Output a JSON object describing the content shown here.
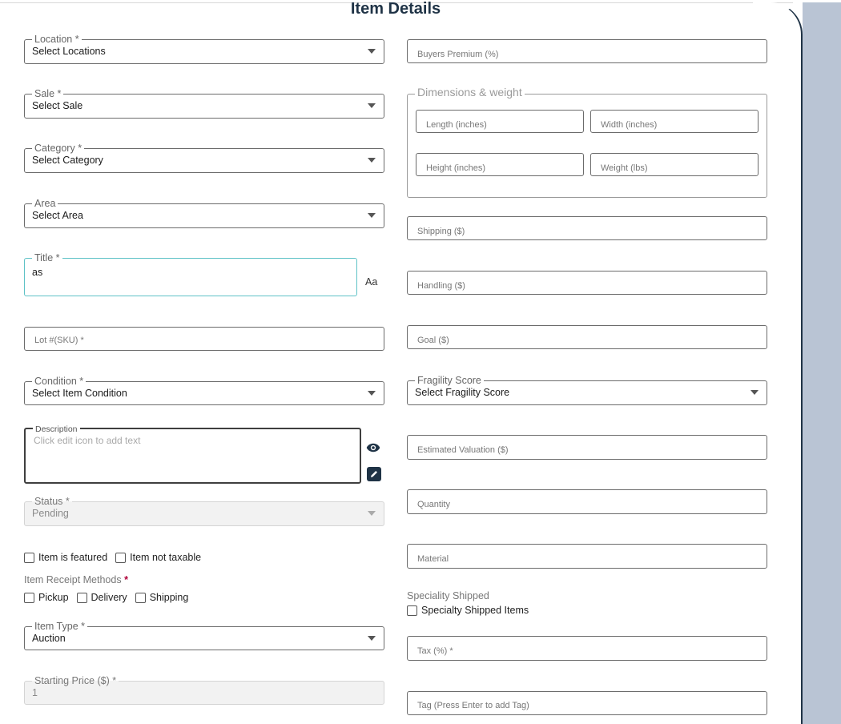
{
  "page": {
    "title": "Item Details"
  },
  "left": {
    "location": {
      "label": "Location *",
      "value": "Select Locations"
    },
    "sale": {
      "label": "Sale *",
      "value": "Select Sale"
    },
    "category": {
      "label": "Category *",
      "value": "Select Category"
    },
    "area": {
      "label": "Area",
      "value": "Select Area"
    },
    "title_field": {
      "label": "Title *",
      "value": "as",
      "aa_label": "Aa"
    },
    "lot": {
      "placeholder": "Lot #(SKU) *"
    },
    "condition": {
      "label": "Condition *",
      "value": "Select Item Condition"
    },
    "description": {
      "label": "Description",
      "placeholder": "Click edit icon to add text"
    },
    "status": {
      "label": "Status *",
      "value": "Pending"
    },
    "featured_label": "Item is featured",
    "not_taxable_label": "Item not taxable",
    "receipt_methods": {
      "label": "Item Receipt Methods",
      "required_mark": "*",
      "options": [
        "Pickup",
        "Delivery",
        "Shipping"
      ]
    },
    "item_type": {
      "label": "Item Type *",
      "value": "Auction"
    },
    "starting_price": {
      "label": "Starting Price ($) *",
      "value": "1"
    }
  },
  "right": {
    "buyers_premium": {
      "placeholder": "Buyers Premium (%)"
    },
    "dimensions": {
      "label": "Dimensions & weight",
      "length": "Length (inches)",
      "width": "Width (inches)",
      "height": "Height (inches)",
      "weight": "Weight (lbs)"
    },
    "shipping": {
      "placeholder": "Shipping ($)"
    },
    "handling": {
      "placeholder": "Handling ($)"
    },
    "goal": {
      "placeholder": "Goal ($)"
    },
    "fragility": {
      "label": "Fragility Score",
      "value": "Select Fragility Score"
    },
    "valuation": {
      "placeholder": "Estimated Valuation ($)"
    },
    "quantity": {
      "placeholder": "Quantity"
    },
    "material": {
      "placeholder": "Material"
    },
    "speciality": {
      "label": "Speciality Shipped",
      "option": "Specialty Shipped Items"
    },
    "tax": {
      "placeholder": "Tax (%) *"
    },
    "tag": {
      "placeholder": "Tag (Press Enter to add Tag)"
    }
  },
  "colors": {
    "accent": "#1f3346",
    "focus": "#5ec2c6",
    "side_panel": "#b9c4d4",
    "required": "#b0003a"
  },
  "icons": {
    "preview": "eye-icon",
    "edit": "pencil-icon",
    "dropdown": "chevron-down-icon"
  }
}
